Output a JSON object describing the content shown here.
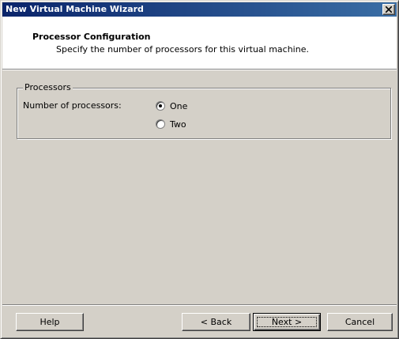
{
  "window": {
    "title": "New Virtual Machine Wizard"
  },
  "header": {
    "title": "Processor Configuration",
    "subtitle": "Specify the number of processors for this virtual machine."
  },
  "processors": {
    "group_label": "Processors",
    "field_label": "Number of processors:",
    "options": [
      {
        "label": "One",
        "selected": true
      },
      {
        "label": "Two",
        "selected": false
      }
    ]
  },
  "buttons": {
    "help": "Help",
    "back": "< Back",
    "next": "Next >",
    "cancel": "Cancel"
  },
  "icons": {
    "close": "close-icon"
  },
  "colors": {
    "titlebar_start": "#0a246a",
    "titlebar_end": "#3a6ea5",
    "face": "#d4d0c8"
  }
}
